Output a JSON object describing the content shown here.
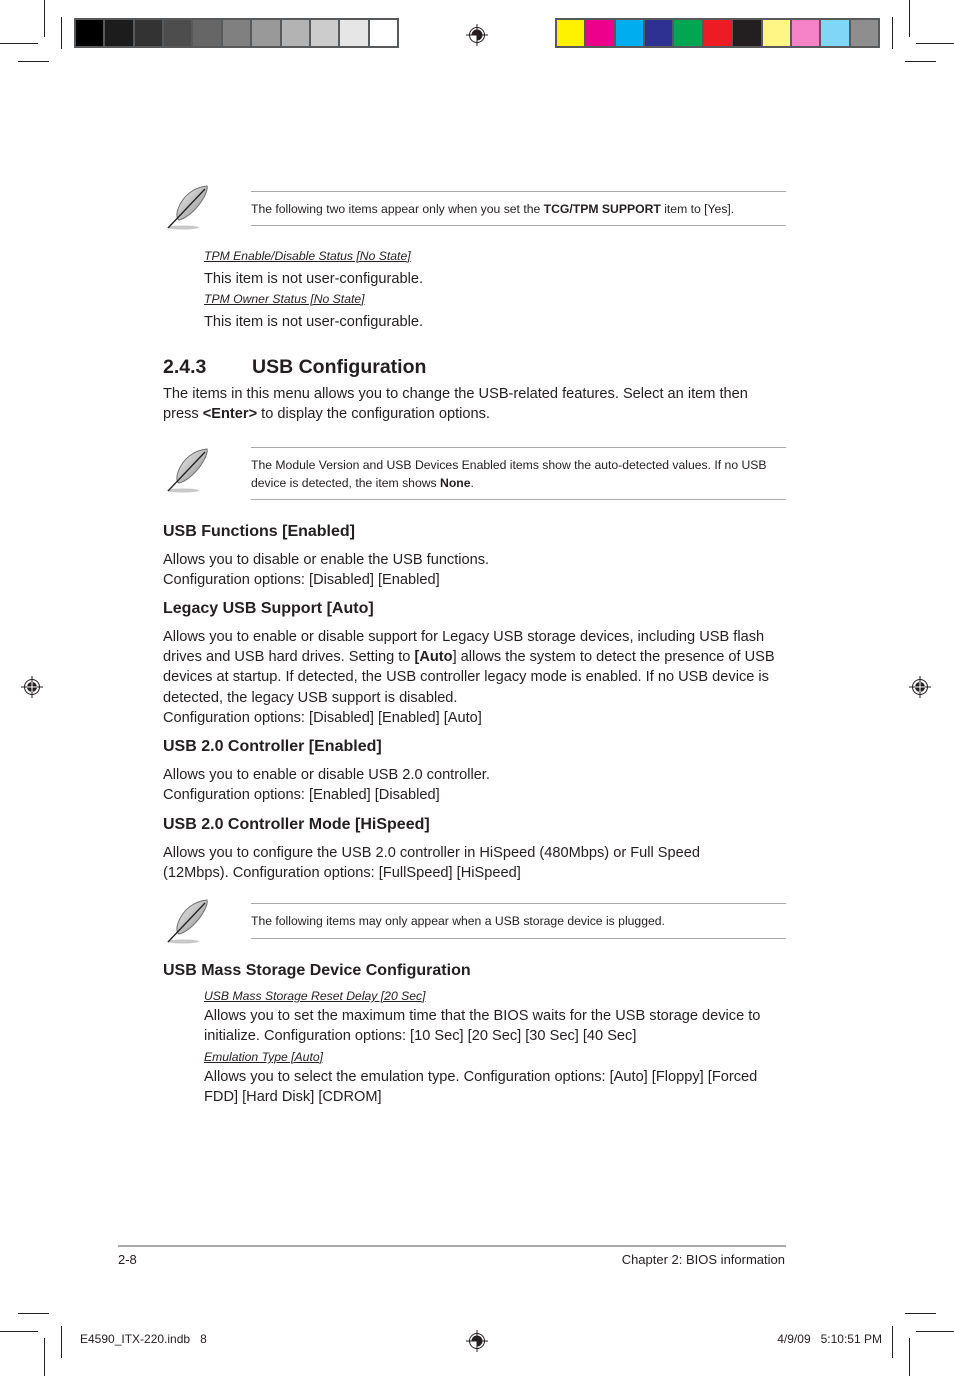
{
  "print_marks": {
    "grayscale_swatches": [
      "#000000",
      "#1c1c1c",
      "#333333",
      "#4d4d4d",
      "#666666",
      "#808080",
      "#999999",
      "#b3b3b3",
      "#cccccc",
      "#e6e6e6",
      "#ffffff"
    ],
    "color_swatches": [
      "#fff200",
      "#ec008c",
      "#00aeef",
      "#2e3192",
      "#00a651",
      "#ed1c24",
      "#231f20",
      "#fff685",
      "#f682c8",
      "#7fd6f7",
      "#8f8e8e"
    ],
    "slug_left": "E4590_ITX-220.indb   8",
    "slug_right": "4/9/09   5:10:51 PM"
  },
  "notes": [
    {
      "pre": "The following two items appear only when you set the ",
      "bold": "TCG/TPM SUPPORT",
      "post": " item to [Yes]."
    },
    {
      "pre": "The Module Version and USB Devices Enabled items show the auto-detected values. If no USB device is detected, the item shows ",
      "bold": "None",
      "post": "."
    },
    {
      "pre": "The following items may only appear when a USB storage device is plugged.",
      "bold": "",
      "post": ""
    }
  ],
  "tpm": [
    {
      "title": "TPM Enable/Disable Status [No State]",
      "desc": "This item is not user-configurable."
    },
    {
      "title": "TPM Owner Status [No State]",
      "desc": "This item is not user-configurable."
    }
  ],
  "section": {
    "number": "2.4.3",
    "title": "USB Configuration",
    "intro_pre": "The items in this menu allows you to change the USB-related features. Select an item then press ",
    "intro_bold": "<Enter>",
    "intro_post": " to display the configuration options."
  },
  "items": [
    {
      "title": "USB Functions [Enabled]",
      "lines": [
        "Allows you to disable or enable the USB functions.",
        "Configuration options: [Disabled] [Enabled]"
      ]
    },
    {
      "title": "Legacy USB Support [Auto]",
      "p1": "Allows you to enable or disable support for Legacy USB storage devices, including USB flash drives and USB hard drives. Setting to ",
      "p_bold": "[Auto",
      "p2": "] allows the system to detect the presence of USB devices at startup. If detected, the USB controller legacy mode is enabled. If no USB device is detected, the legacy USB support is disabled.",
      "options": "Configuration options: [Disabled] [Enabled] [Auto]"
    },
    {
      "title": "USB 2.0 Controller [Enabled]",
      "lines": [
        "Allows you to enable or disable USB 2.0 controller.",
        "Configuration options: [Enabled] [Disabled]"
      ]
    },
    {
      "title": "USB 2.0 Controller Mode [HiSpeed]",
      "desc": "Allows you to configure the USB 2.0 controller in HiSpeed (480Mbps) or Full Speed (12Mbps). Configuration options: [FullSpeed] [HiSpeed]"
    },
    {
      "title": "USB Mass Storage Device Configuration"
    }
  ],
  "mass_storage": [
    {
      "title": "USB Mass Storage Reset Delay [20 Sec]",
      "desc": "Allows you to set the maximum time that the BIOS waits for the USB storage device to initialize. Configuration options: [10 Sec] [20 Sec] [30 Sec] [40 Sec]"
    },
    {
      "title": "Emulation Type [Auto]",
      "desc": "Allows you to select the emulation type. Configuration options: [Auto] [Floppy] [Forced FDD] [Hard Disk] [CDROM]"
    }
  ],
  "footer": {
    "page_number": "2-8",
    "chapter": "Chapter 2: BIOS information"
  }
}
